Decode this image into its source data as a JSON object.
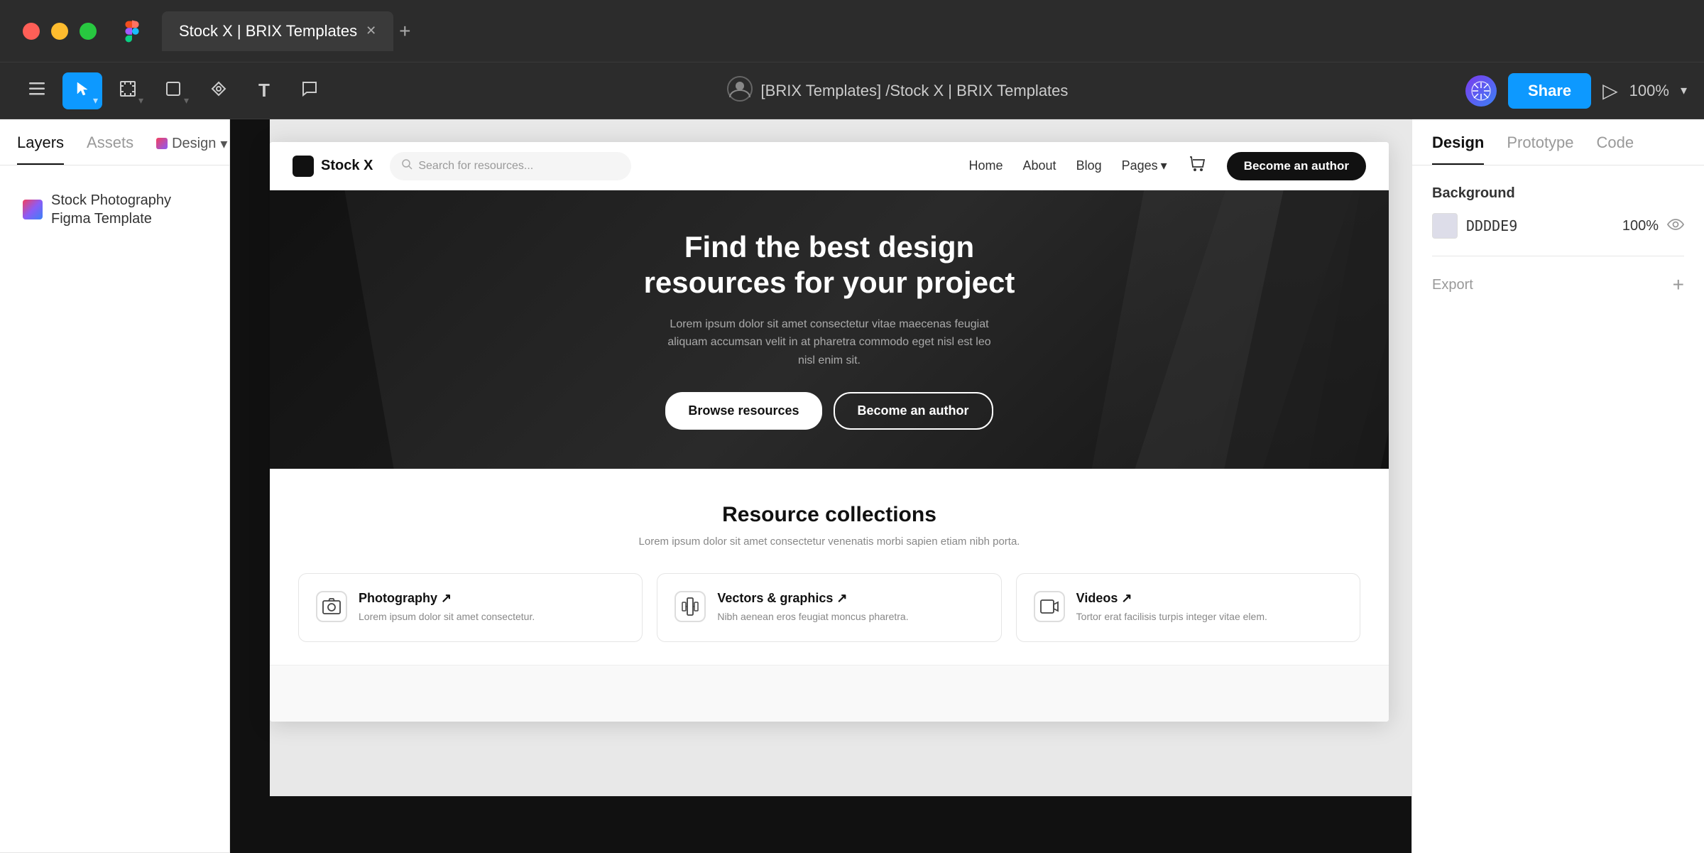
{
  "window": {
    "traffic_lights": [
      "red",
      "yellow",
      "green"
    ],
    "tab_title": "Stock X | BRIX Templates",
    "tab_add": "+"
  },
  "toolbar": {
    "menu_icon": "☰",
    "select_tool": "▶",
    "frame_tool": "#",
    "shape_tool": "□",
    "pen_tool": "✒",
    "text_tool": "T",
    "comment_tool": "💬",
    "breadcrumb": "[BRIX Templates] /Stock X | BRIX Templates",
    "share_label": "Share",
    "play_icon": "▷",
    "zoom_level": "100%"
  },
  "left_panel": {
    "tab_layers": "Layers",
    "tab_assets": "Assets",
    "design_badge": "✦ Design",
    "layer_item": {
      "name": "Stock Photography Figma Template"
    }
  },
  "right_panel": {
    "tab_design": "Design",
    "tab_prototype": "Prototype",
    "tab_code": "Code",
    "background_section": {
      "label": "Background",
      "color_hex": "DDDDE9",
      "color_opacity": "100%"
    },
    "export_section": {
      "label": "Export",
      "add_icon": "+"
    }
  },
  "website": {
    "nav": {
      "logo": "Stock X",
      "search_placeholder": "Search for resources...",
      "links": [
        "Home",
        "About",
        "Blog"
      ],
      "pages_label": "Pages",
      "cta_label": "Become an author"
    },
    "hero": {
      "title_line1": "Find the best design",
      "title_line2": "resources for your project",
      "subtitle": "Lorem ipsum dolor sit amet consectetur vitae maecenas feugiat aliquam accumsan velit in at pharetra commodo eget nisl est leo nisl enim sit.",
      "btn_browse": "Browse resources",
      "btn_author": "Become an author"
    },
    "collections": {
      "title": "Resource collections",
      "subtitle": "Lorem ipsum dolor sit amet consectetur venenatis morbi sapien etiam nibh porta.",
      "items": [
        {
          "icon": "📷",
          "name": "Photography ↗",
          "description": "Lorem ipsum dolor sit amet consectetur."
        },
        {
          "icon": "✏️",
          "name": "Vectors & graphics ↗",
          "description": "Nibh aenean eros feugiat moncus pharetra."
        },
        {
          "icon": "▶",
          "name": "Videos ↗",
          "description": "Tortor erat facilisis turpis integer vitae elem."
        }
      ]
    }
  }
}
